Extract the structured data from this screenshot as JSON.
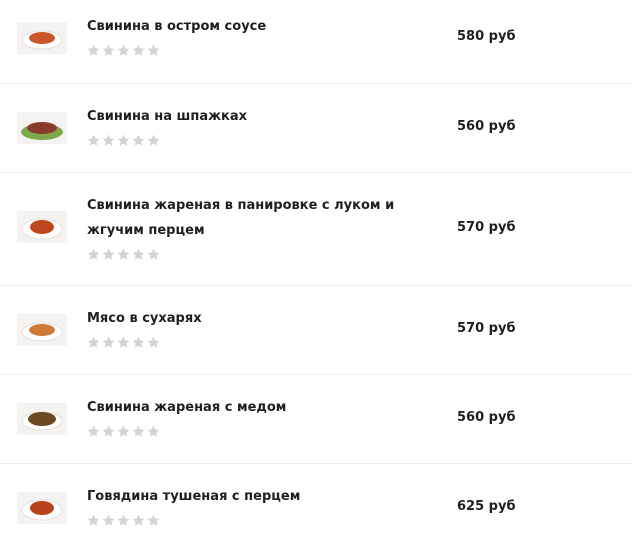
{
  "menu": {
    "items": [
      {
        "name": "Свинина в остром соусе",
        "price": "580 руб",
        "rating": 0,
        "dish_color": "#c8562a"
      },
      {
        "name": "Свинина на шпажках",
        "price": "560 руб",
        "rating": 0,
        "dish_color": "#8a3a2a"
      },
      {
        "name": "Свинина жареная в панировке с луком и жгучим перцем",
        "price": "570 руб",
        "rating": 0,
        "dish_color": "#c0461e"
      },
      {
        "name": "Мясо в сухарях",
        "price": "570 руб",
        "rating": 0,
        "dish_color": "#d07a3a"
      },
      {
        "name": "Свинина жареная с медом",
        "price": "560 руб",
        "rating": 0,
        "dish_color": "#6b4a22"
      },
      {
        "name": "Говядина тушеная с перцем",
        "price": "625 руб",
        "rating": 0,
        "dish_color": "#b8421c"
      }
    ]
  },
  "colors": {
    "star_empty": "#d4d4d4",
    "plate": "#ffffff"
  },
  "icons": {
    "rating": "star-icon"
  }
}
